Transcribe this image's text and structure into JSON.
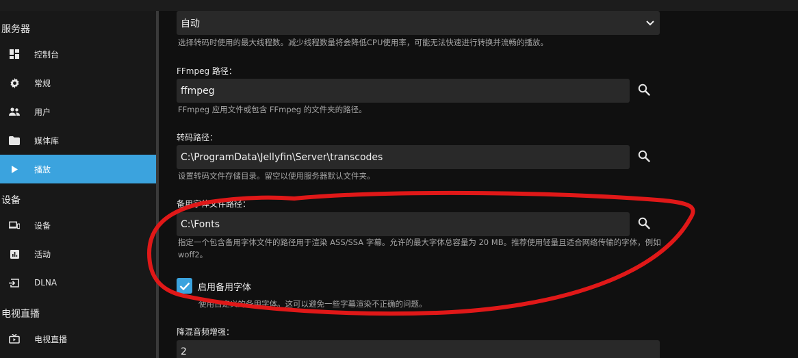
{
  "sidebar": {
    "sections": [
      {
        "title": "服务器",
        "items": [
          {
            "label": "控制台",
            "icon": "dashboard-icon"
          },
          {
            "label": "常规",
            "icon": "gear-icon"
          },
          {
            "label": "用户",
            "icon": "users-icon"
          },
          {
            "label": "媒体库",
            "icon": "folder-icon"
          },
          {
            "label": "播放",
            "icon": "play-icon",
            "active": true
          }
        ]
      },
      {
        "title": "设备",
        "items": [
          {
            "label": "设备",
            "icon": "devices-icon"
          },
          {
            "label": "活动",
            "icon": "activity-icon"
          },
          {
            "label": "DLNA",
            "icon": "dlna-icon"
          }
        ]
      },
      {
        "title": "电视直播",
        "items": [
          {
            "label": "电视直播",
            "icon": "live-tv-icon"
          }
        ]
      }
    ]
  },
  "main": {
    "threads": {
      "value": "自动",
      "help": "选择转码时使用的最大线程数。减少线程数量将会降低CPU使用率，可能无法快速进行转换并流畅的播放。"
    },
    "ffmpeg": {
      "label": "FFmpeg 路径：",
      "value": "ffmpeg",
      "help": "FFmpeg 应用文件或包含 FFmpeg 的文件夹的路径。"
    },
    "transcode": {
      "label": "转码路径：",
      "value": "C:\\ProgramData\\Jellyfin\\Server\\transcodes",
      "help": "设置转码文件存储目录。留空以使用服务器默认文件夹。"
    },
    "fallback_font": {
      "label": "备用字体文件路径：",
      "value": "C:\\Fonts",
      "help": "指定一个包含备用字体文件的路径用于渲染 ASS/SSA 字幕。允许的最大字体总容量为 20 MB。推荐使用轻量且适合网络传输的字体，例如 woff2。"
    },
    "enable_fallback": {
      "label": "启用备用字体",
      "checked": true,
      "help": "使用自定义的备用字体。这可以避免一些字幕渲染不正确的问题。"
    },
    "downmix": {
      "label": "降混音频增强：",
      "value": "2"
    }
  },
  "colors": {
    "accent": "#3ba3de",
    "annotation": "#e01818",
    "background": "#101010",
    "input": "#292929"
  }
}
